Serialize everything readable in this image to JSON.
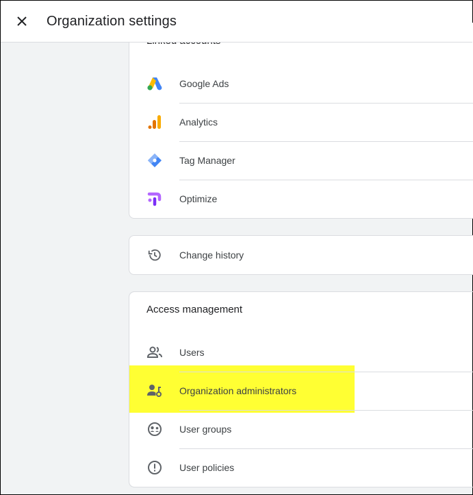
{
  "header": {
    "title": "Organization settings",
    "close_icon": "close-icon"
  },
  "linked_accounts": {
    "title": "Linked accounts",
    "items": [
      {
        "label": "Google Ads",
        "icon": "google-ads-icon"
      },
      {
        "label": "Analytics",
        "icon": "analytics-icon"
      },
      {
        "label": "Tag Manager",
        "icon": "tag-manager-icon"
      },
      {
        "label": "Optimize",
        "icon": "optimize-icon"
      }
    ]
  },
  "change_history": {
    "label": "Change history",
    "icon": "history-icon"
  },
  "access_management": {
    "title": "Access management",
    "items": [
      {
        "label": "Users",
        "icon": "users-icon"
      },
      {
        "label": "Organization administrators",
        "icon": "admin-key-icon",
        "highlighted": true
      },
      {
        "label": "User groups",
        "icon": "user-groups-icon"
      },
      {
        "label": "User policies",
        "icon": "policy-alert-icon"
      }
    ]
  },
  "colors": {
    "highlight": "#ffff33",
    "google_blue": "#4285f4",
    "google_yellow": "#fbbc04",
    "google_green": "#34a853",
    "analytics_orange": "#f9ab00",
    "analytics_dark": "#e37400",
    "optimize_purple": "#b366ff"
  }
}
